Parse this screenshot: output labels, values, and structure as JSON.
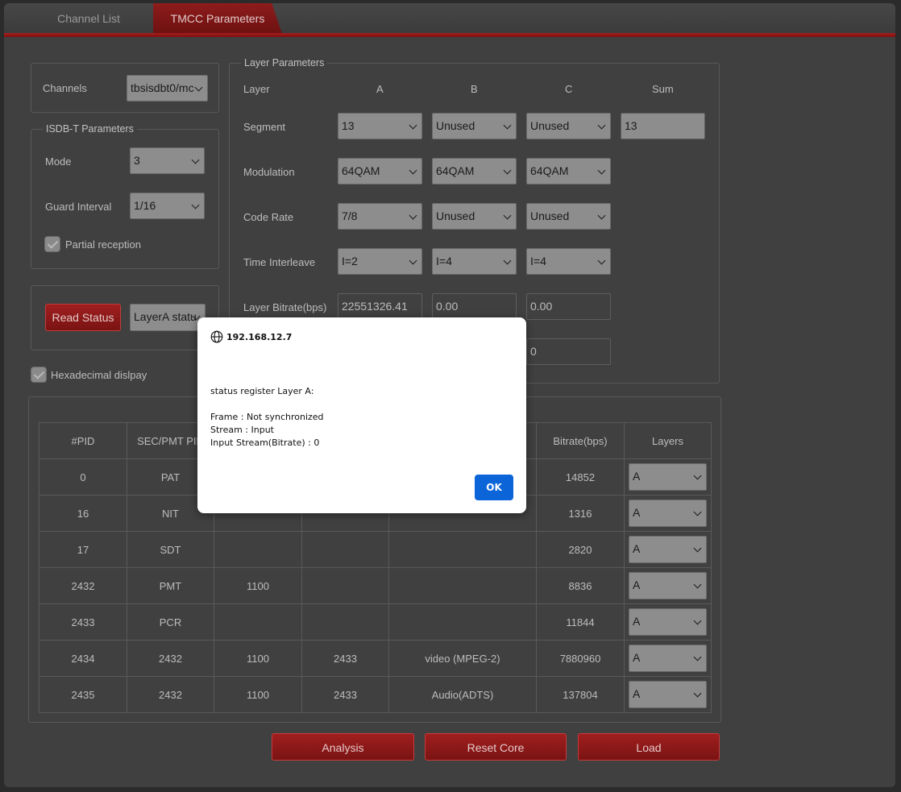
{
  "tabs": [
    {
      "label": "Channel List"
    },
    {
      "label": "TMCC Parameters"
    }
  ],
  "channels": {
    "label": "Channels",
    "value": "tbsisdbt0/mc"
  },
  "isdbt": {
    "legend": "ISDB-T Parameters",
    "mode_label": "Mode",
    "mode_value": "3",
    "guard_label": "Guard Interval",
    "guard_value": "1/16",
    "partial_label": "Partial reception"
  },
  "status": {
    "read_button": "Read Status",
    "layer_select": "LayerA statu"
  },
  "hex_label": "Hexadecimal dislpay",
  "layer_params": {
    "legend": "Layer Parameters",
    "col_headers": [
      "Layer",
      "A",
      "B",
      "C",
      "Sum"
    ],
    "segment": {
      "label": "Segment",
      "a": "13",
      "b": "Unused",
      "c": "Unused",
      "sum": "13"
    },
    "modulation": {
      "label": "Modulation",
      "a": "64QAM",
      "b": "64QAM",
      "c": "64QAM"
    },
    "code_rate": {
      "label": "Code Rate",
      "a": "7/8",
      "b": "Unused",
      "c": "Unused"
    },
    "time_interleave": {
      "label": "Time Interleave",
      "a": "I=2",
      "b": "I=4",
      "c": "I=4"
    },
    "bitrate": {
      "label": "Layer Bitrate(bps)",
      "a": "22551326.41",
      "b": "0.00",
      "c": "0.00"
    },
    "extra_c": "0"
  },
  "pid_table": {
    "headers": [
      "#PID",
      "SEC/PMT PID",
      "",
      "",
      "",
      "Bitrate(bps)",
      "Layers"
    ],
    "rows": [
      {
        "pid": "0",
        "sec": "PAT",
        "c3": "",
        "c4": "",
        "c5": "",
        "bitrate": "14852",
        "layer": "A"
      },
      {
        "pid": "16",
        "sec": "NIT",
        "c3": "",
        "c4": "",
        "c5": "",
        "bitrate": "1316",
        "layer": "A"
      },
      {
        "pid": "17",
        "sec": "SDT",
        "c3": "",
        "c4": "",
        "c5": "",
        "bitrate": "2820",
        "layer": "A"
      },
      {
        "pid": "2432",
        "sec": "PMT",
        "c3": "1100",
        "c4": "",
        "c5": "",
        "bitrate": "8836",
        "layer": "A"
      },
      {
        "pid": "2433",
        "sec": "PCR",
        "c3": "",
        "c4": "",
        "c5": "",
        "bitrate": "11844",
        "layer": "A"
      },
      {
        "pid": "2434",
        "sec": "2432",
        "c3": "1100",
        "c4": "2433",
        "c5": "video (MPEG-2)",
        "bitrate": "7880960",
        "layer": "A"
      },
      {
        "pid": "2435",
        "sec": "2432",
        "c3": "1100",
        "c4": "2433",
        "c5": "Audio(ADTS)",
        "bitrate": "137804",
        "layer": "A"
      }
    ]
  },
  "bottom_buttons": {
    "analysis": "Analysis",
    "reset": "Reset Core",
    "load": "Load"
  },
  "dialog": {
    "host": "192.168.12.7",
    "title_line": "status register Layer A:",
    "lines": [
      "Frame : Not synchronized",
      "Stream : Input",
      "Input Stream(Bitrate) : 0"
    ],
    "ok": "OK"
  }
}
